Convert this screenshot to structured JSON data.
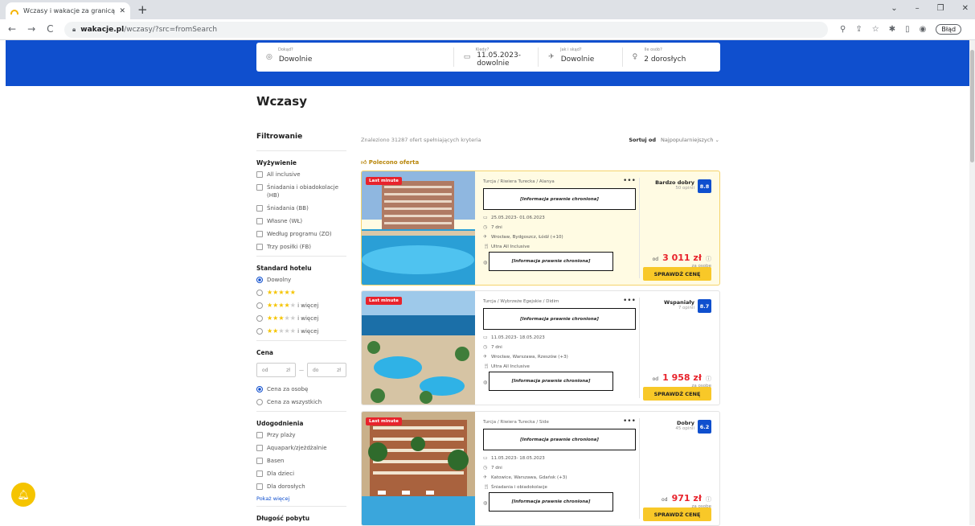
{
  "browser": {
    "tab_title": "Wczasy i wakacje za granicą na W",
    "tab_close": "✕",
    "new_tab": "+",
    "url_domain": "wakacje.pl",
    "url_path": "/wczasy/?src=fromSearch",
    "error_badge": "Błąd",
    "window_controls": [
      "⌄",
      "–",
      "❐",
      "✕"
    ],
    "nav_icons": [
      "←",
      "→",
      "C"
    ]
  },
  "search": {
    "fields": [
      {
        "label": "Dokąd?",
        "value": "Dowolnie",
        "icon": "◎"
      },
      {
        "label": "Kiedy?",
        "value": "11.05.2023-dowolnie",
        "icon": "▭"
      },
      {
        "label": "Jak i skąd?",
        "value": "Dowolnie",
        "icon": "✈"
      },
      {
        "label": "Ile osób?",
        "value": "2 dorosłych",
        "icon": "♀"
      }
    ]
  },
  "page_title": "Wczasy",
  "filters": {
    "heading": "Filtrowanie",
    "meal": {
      "title": "Wyżywienie",
      "options": [
        "All inclusive",
        "Śniadania i obiadokolacje (HB)",
        "Śniadania (BB)",
        "Własne (WŁ)",
        "Według programu (ZO)",
        "Trzy posiłki (FB)"
      ]
    },
    "standard": {
      "title": "Standard hotelu",
      "any": "Dowolny",
      "more": "i więcej"
    },
    "price": {
      "title": "Cena",
      "from": "od",
      "to": "do",
      "currency": "zł",
      "per_person": "Cena za osobę",
      "for_all": "Cena za wszystkich"
    },
    "amenities": {
      "title": "Udogodnienia",
      "options": [
        "Przy plaży",
        "Aquapark/zjeżdżalnie",
        "Basen",
        "Dla dzieci",
        "Dla dorosłych"
      ],
      "show_more": "Pokaż więcej"
    },
    "stay_length": "Długość pobytu"
  },
  "results": {
    "count_text": "Znaleziono 31287 ofert spełniających kryteria",
    "sort_label": "Sortuj od",
    "sort_value": "Najpopularniejszych",
    "recommended": "Polecono oferta"
  },
  "offers": [
    {
      "badge": "Last minute",
      "location": "Turcja / Riwiera Turecka / Alanya",
      "redacted": "[Informacja prawnie chroniona]",
      "dates": "25.05.2023- 01.06.2023",
      "duration": "7 dni",
      "departures": "Wrocław, Bydgoszcz, Łódź  (+10)",
      "meal": "Ultra All Inclusive",
      "rating_word": "Bardzo dobry",
      "reviews": "50 opinii",
      "score": "8.8",
      "price_from": "od",
      "price": "3 011 zł",
      "per_person": "za osobę",
      "button": "SPRAWDŹ CENĘ"
    },
    {
      "badge": "Last minute",
      "location": "Turcja / Wybrzeże Egejskie / Didim",
      "redacted": "[Informacja prawnie chroniona]",
      "dates": "11.05.2023- 18.05.2023",
      "duration": "7 dni",
      "departures": "Wrocław, Warszawa, Rzeszów  (+3)",
      "meal": "Ultra All Inclusive",
      "rating_word": "Wspaniały",
      "reviews": "7 opinii",
      "score": "8.7",
      "price_from": "od",
      "price": "1 958 zł",
      "per_person": "za osobę",
      "button": "SPRAWDŹ CENĘ"
    },
    {
      "badge": "Last minute",
      "location": "Turcja / Riwiera Turecka / Side",
      "redacted": "[Informacja prawnie chroniona]",
      "dates": "11.05.2023- 18.05.2023",
      "duration": "7 dni",
      "departures": "Katowice, Warszawa, Gdańsk  (+3)",
      "meal": "Śniadania i obiadokolacje",
      "rating_word": "Dobry",
      "reviews": "45 opinii",
      "score": "6.2",
      "price_from": "od",
      "price": "971 zł",
      "per_person": "za osobę",
      "button": "SPRAWDŹ CENĘ"
    }
  ]
}
